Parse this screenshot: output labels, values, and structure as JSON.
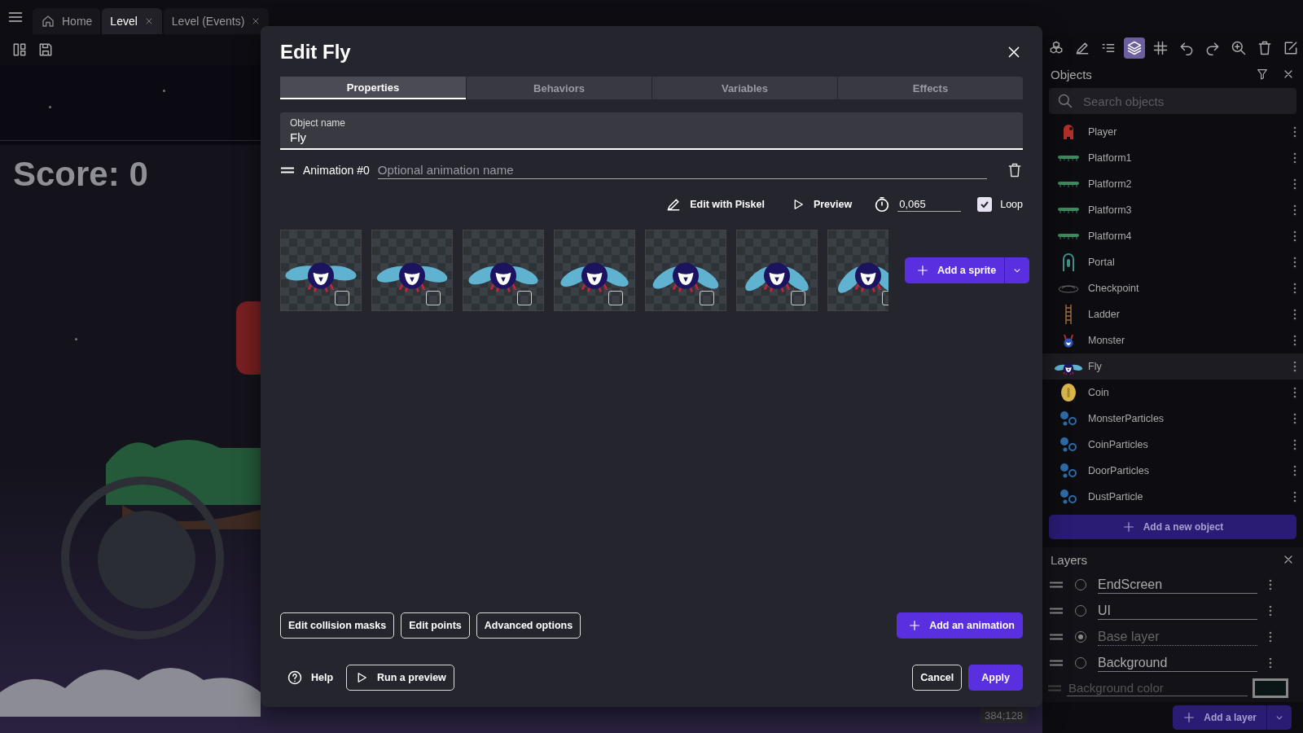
{
  "tabs": [
    {
      "label": "Home",
      "kind": "home",
      "selected": false
    },
    {
      "label": "Level",
      "kind": "document",
      "selected": true
    },
    {
      "label": "Level (Events)",
      "kind": "document",
      "selected": false
    }
  ],
  "canvas": {
    "score_text": "Score: 0",
    "coordinates": "384;128"
  },
  "toolbar_tools": [
    {
      "kind": "objects",
      "selected": false
    },
    {
      "kind": "pen",
      "selected": false
    },
    {
      "kind": "list",
      "selected": false
    },
    {
      "kind": "layers",
      "selected": true
    },
    {
      "kind": "grid",
      "selected": false
    },
    {
      "kind": "undo",
      "selected": false
    },
    {
      "kind": "redo",
      "selected": false
    },
    {
      "kind": "zoom",
      "selected": false
    },
    {
      "kind": "trash",
      "selected": false
    },
    {
      "kind": "edit",
      "selected": false
    }
  ],
  "dialog": {
    "title": "Edit Fly",
    "tabs": [
      {
        "label": "Properties",
        "selected": true
      },
      {
        "label": "Behaviors",
        "selected": false
      },
      {
        "label": "Variables",
        "selected": false
      },
      {
        "label": "Effects",
        "selected": false
      }
    ],
    "object_name": {
      "label": "Object name",
      "value": "Fly"
    },
    "animation": {
      "label": "Animation #0",
      "placeholder": "Optional animation name",
      "edit_label": "Edit with Piskel",
      "preview_label": "Preview",
      "timer_value": "0,065",
      "loop": {
        "label": "Loop",
        "checked": true
      },
      "frames": [
        {
          "selected": false
        },
        {
          "selected": false
        },
        {
          "selected": false
        },
        {
          "selected": false
        },
        {
          "selected": false
        },
        {
          "selected": false
        },
        {
          "selected": false
        }
      ],
      "add_sprite": "Add a sprite"
    },
    "secondary_buttons": [
      "Edit collision masks",
      "Edit points",
      "Advanced options"
    ],
    "add_animation": "Add an animation",
    "help": "Help",
    "run_preview": "Run a preview",
    "cancel": "Cancel",
    "apply": "Apply"
  },
  "objects_panel": {
    "title": "Objects",
    "search_placeholder": "Search objects",
    "items": [
      {
        "name": "Player",
        "kind": "character",
        "selected": false
      },
      {
        "name": "Platform1",
        "kind": "platform",
        "selected": false
      },
      {
        "name": "Platform2",
        "kind": "platform",
        "selected": false
      },
      {
        "name": "Platform3",
        "kind": "platform",
        "selected": false
      },
      {
        "name": "Platform4",
        "kind": "platform",
        "selected": false
      },
      {
        "name": "Portal",
        "kind": "portal",
        "selected": false
      },
      {
        "name": "Checkpoint",
        "kind": "checkpoint",
        "selected": false
      },
      {
        "name": "Ladder",
        "kind": "ladder",
        "selected": false
      },
      {
        "name": "Monster",
        "kind": "monster",
        "selected": false
      },
      {
        "name": "Fly",
        "kind": "fly",
        "selected": true
      },
      {
        "name": "Coin",
        "kind": "coin",
        "selected": false
      },
      {
        "name": "MonsterParticles",
        "kind": "particles",
        "selected": false
      },
      {
        "name": "CoinParticles",
        "kind": "particles",
        "selected": false
      },
      {
        "name": "DoorParticles",
        "kind": "particles",
        "selected": false
      },
      {
        "name": "DustParticle",
        "kind": "particles",
        "selected": false
      }
    ],
    "add_button": "Add a new object"
  },
  "layers_panel": {
    "title": "Layers",
    "layers": [
      {
        "name": "EndScreen",
        "selected": false
      },
      {
        "name": "UI",
        "selected": false
      },
      {
        "placeholder": "Base layer",
        "selected": true
      },
      {
        "name": "Background",
        "selected": false
      }
    ],
    "background_color": {
      "placeholder": "Background color",
      "color": "#0b1616"
    },
    "add_button": "Add a layer"
  }
}
